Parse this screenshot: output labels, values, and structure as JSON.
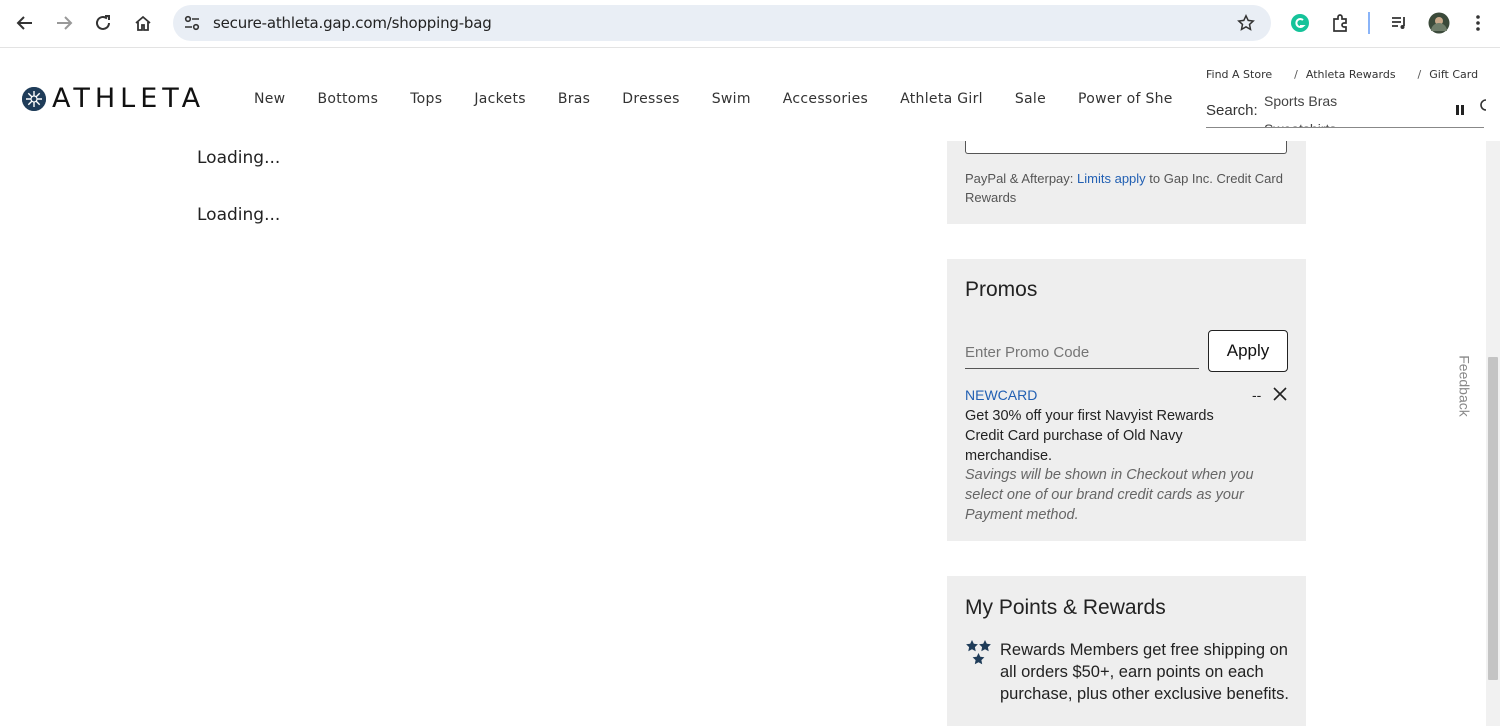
{
  "browser": {
    "url": "secure-athleta.gap.com/shopping-bag"
  },
  "header": {
    "logo_text": "ATHLETA",
    "nav": [
      "New",
      "Bottoms",
      "Tops",
      "Jackets",
      "Bras",
      "Dresses",
      "Swim",
      "Accessories",
      "Athleta Girl",
      "Sale",
      "Power of She"
    ],
    "utility": {
      "find_store": "Find A Store",
      "rewards": "Athleta Rewards",
      "gift_card": "Gift Card"
    },
    "search": {
      "label": "Search:",
      "ticker_prev": "Sports Bras",
      "ticker_current": "Sweatshirts"
    }
  },
  "main": {
    "loading_1": "Loading...",
    "loading_2": "Loading..."
  },
  "payment_note": {
    "prefix": "PayPal & Afterpay:",
    "link": "Limits apply",
    "suffix": "to Gap Inc. Credit Card Rewards"
  },
  "promos": {
    "title": "Promos",
    "input_placeholder": "Enter Promo Code",
    "apply_label": "Apply",
    "code": "NEWCARD",
    "amount": "--",
    "description": "Get 30% off your first Navyist Rewards Credit Card purchase of Old Navy merchandise.",
    "savings_note": "Savings will be shown in Checkout when you select one of our brand credit cards as your Payment method."
  },
  "rewards": {
    "title": "My Points & Rewards",
    "text": "Rewards Members get free shipping on all orders $50+, earn points on each purchase, plus other exclusive benefits."
  },
  "feedback_label": "Feedback",
  "colors": {
    "link_blue": "#2260b3",
    "panel_bg": "#eeeeee",
    "brand_navy": "#1f3c59"
  }
}
